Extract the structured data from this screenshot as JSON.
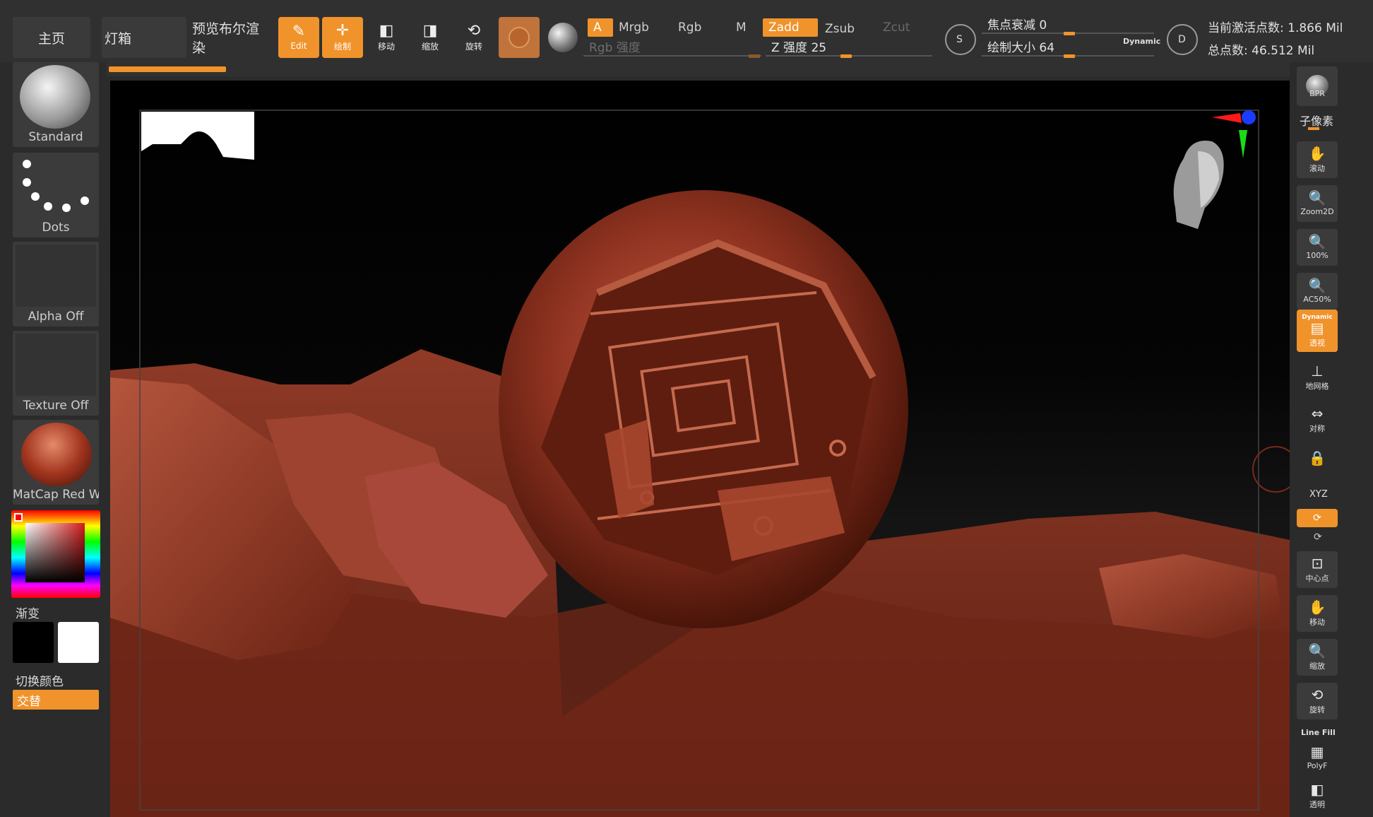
{
  "app_tabs": [
    {
      "label": "主页"
    },
    {
      "label": "灯箱"
    },
    {
      "label": "预览布尔渲染"
    }
  ],
  "tools": [
    {
      "label": "Edit",
      "icon": "edit-icon",
      "active": true
    },
    {
      "label": "绘制",
      "icon": "draw-icon",
      "active": true
    },
    {
      "label": "移动",
      "icon": "move-icon",
      "active": false
    },
    {
      "label": "缩放",
      "icon": "scale-icon",
      "active": false
    },
    {
      "label": "旋转",
      "icon": "rotate-icon",
      "active": false
    }
  ],
  "channels": {
    "a": "A",
    "mrgb": "Mrgb",
    "rgb": "Rgb",
    "m": "M",
    "zadd": "Zadd",
    "zsub": "Zsub",
    "zcut": "Zcut"
  },
  "sliders": {
    "rgb_intensity": {
      "label": "Rgb 强度",
      "value": 0.99
    },
    "z_intensity": {
      "label": "Z 强度 25",
      "value": 0.45
    },
    "focal_shift": {
      "label": "焦点衰减 0",
      "value": 0.5
    },
    "draw_size": {
      "label": "绘制大小 64",
      "value": 0.5
    },
    "dynamic_label": "Dynamic"
  },
  "round_icons": {
    "s": "S",
    "d": "D"
  },
  "stats": {
    "active_points": "当前激活点数: 1.866 Mil",
    "total_points": "总点数: 46.512 Mil"
  },
  "left_slots": [
    {
      "label": "Standard",
      "icon": "standard-brush-icon"
    },
    {
      "label": "Dots",
      "icon": "dots-stroke-icon"
    },
    {
      "label": "Alpha Off",
      "icon": "alpha-icon"
    },
    {
      "label": "Texture Off",
      "icon": "texture-icon"
    },
    {
      "label": "MatCap Red Wax",
      "icon": "matcap-icon"
    }
  ],
  "color": {
    "gradient_label": "渐变",
    "switch_label": "切换颜色",
    "alternate_label": "交替",
    "primary": "#000000",
    "secondary": "#ffffff",
    "accent": "#f0932b"
  },
  "right_shelf": {
    "bpr": "BPR",
    "subpixel": "子像素",
    "buttons": [
      {
        "label": "滚动",
        "icon": "scroll-icon",
        "active": false
      },
      {
        "label": "Zoom2D",
        "icon": "zoom2d-icon",
        "active": false
      },
      {
        "label": "100%",
        "icon": "zoom100-icon",
        "active": false
      },
      {
        "label": "AC50%",
        "icon": "ac50-icon",
        "active": false
      },
      {
        "label": "透视",
        "icon": "perspective-icon",
        "active": true
      },
      {
        "label": "地网格",
        "icon": "floor-grid-icon",
        "active": false
      },
      {
        "label": "对称",
        "icon": "symmetry-icon",
        "active": false
      },
      {
        "label": "",
        "icon": "lock-icon",
        "active": false
      },
      {
        "label": "中心点",
        "icon": "center-icon",
        "active": false
      },
      {
        "label": "移动",
        "icon": "move-hand-icon",
        "active": false
      },
      {
        "label": "缩放",
        "icon": "zoom-icon",
        "active": false
      },
      {
        "label": "旋转",
        "icon": "rotate-view-icon",
        "active": false
      },
      {
        "label": "PolyF",
        "icon": "polyframe-icon",
        "active": false
      },
      {
        "label": "透明",
        "icon": "transparent-icon",
        "active": false
      }
    ],
    "xyz": "XYZ",
    "dynamic_tag": "Dynamic",
    "line_fill": "Line Fill"
  }
}
